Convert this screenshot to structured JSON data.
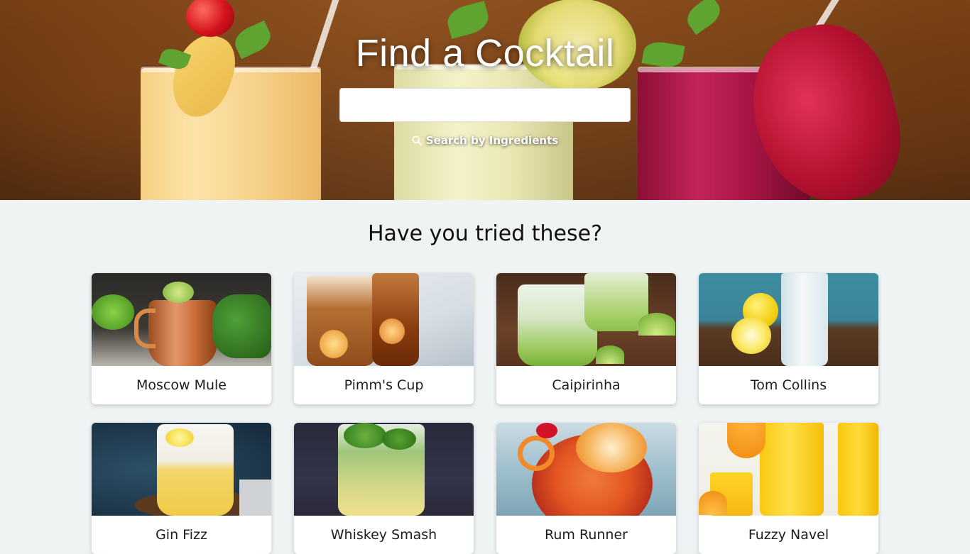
{
  "hero": {
    "title": "Find a Cocktail",
    "search_value": "",
    "ingredients_link": "Search by Ingredients"
  },
  "suggestions": {
    "heading": "Have you tried these?",
    "cards": [
      {
        "name": "Moscow Mule"
      },
      {
        "name": "Pimm's Cup"
      },
      {
        "name": "Caipirinha"
      },
      {
        "name": "Tom Collins"
      },
      {
        "name": "Gin Fizz"
      },
      {
        "name": "Whiskey Smash"
      },
      {
        "name": "Rum Runner"
      },
      {
        "name": "Fuzzy Navel"
      }
    ]
  },
  "icons": {
    "search": "search-icon"
  }
}
